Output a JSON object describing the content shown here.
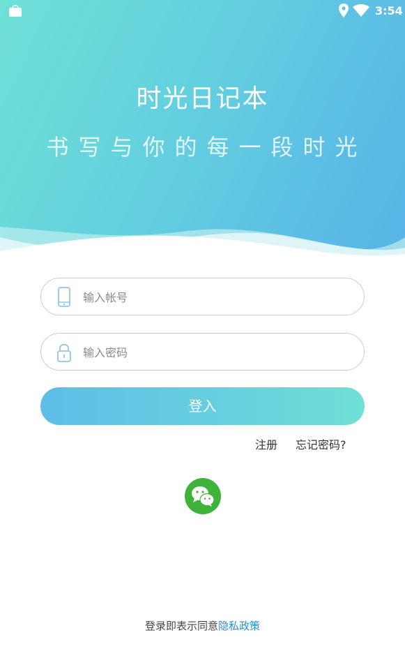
{
  "status_bar": {
    "time": "3:54",
    "left_icon": "shopping-bag-icon",
    "location_icon": "location-pin-icon",
    "wifi_icon": "wifi-icon"
  },
  "header": {
    "title": "时光日记本",
    "subtitle": "书写与你的每一段时光"
  },
  "form": {
    "account_placeholder": "输入帐号",
    "account_icon": "phone-icon",
    "password_placeholder": "输入密码",
    "password_icon": "lock-icon",
    "login_label": "登入",
    "register_label": "注册",
    "forgot_label": "忘记密码?",
    "wechat_icon": "wechat-icon"
  },
  "footer": {
    "agreement_text": "登录即表示同意",
    "policy_link": "隐私政策"
  },
  "colors": {
    "gradient_start": "#6fe0d6",
    "gradient_end": "#57b3e6",
    "wechat_green": "#3fb23a",
    "link_blue": "#2a8fd6"
  }
}
